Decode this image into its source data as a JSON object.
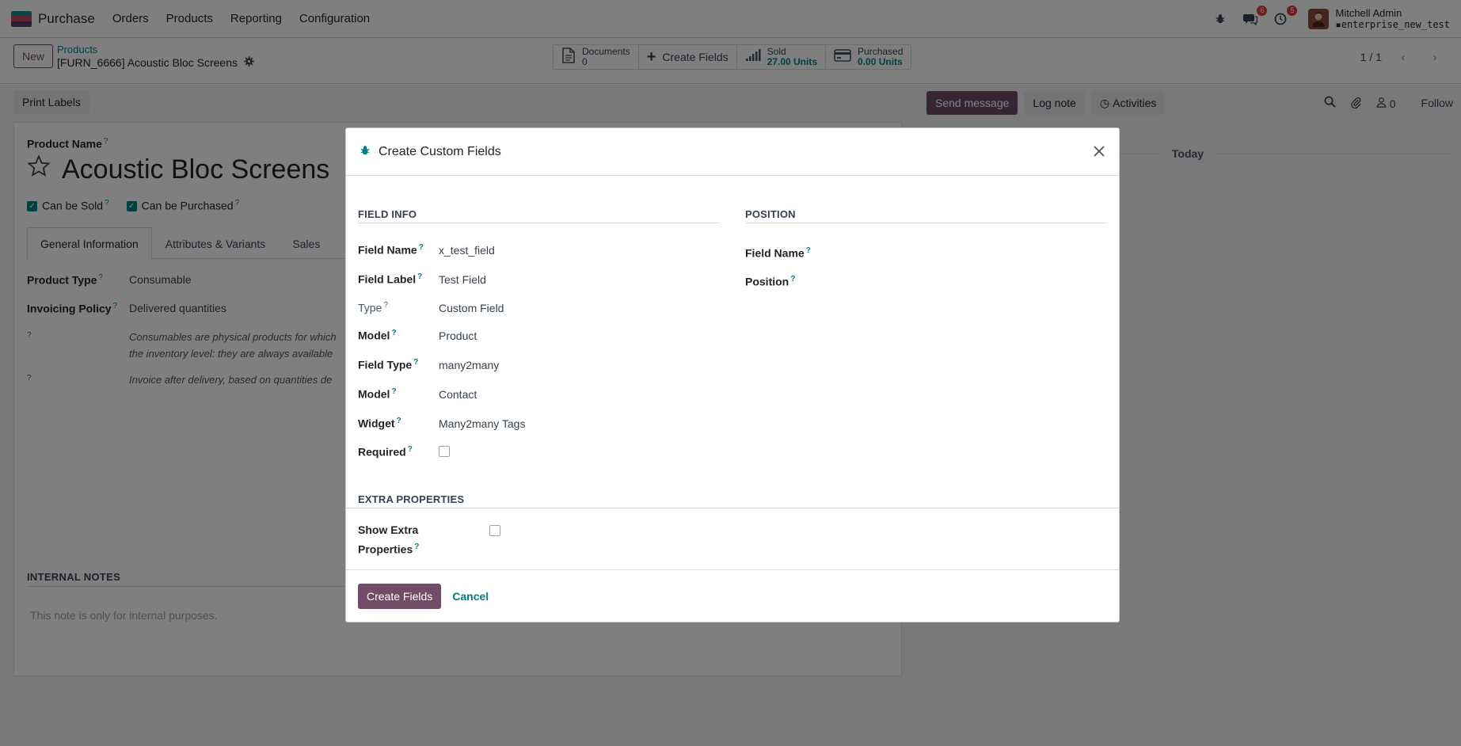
{
  "navbar": {
    "app_name": "Purchase",
    "menu": [
      "Orders",
      "Products",
      "Reporting",
      "Configuration"
    ],
    "messages_badge": "6",
    "activities_badge": "5",
    "user_name": "Mitchell Admin",
    "database": "enterprise_new_test"
  },
  "control_panel": {
    "new_label": "New",
    "breadcrumb_parent": "Products",
    "breadcrumb_current": "[FURN_6666] Acoustic Bloc Screens",
    "smart": {
      "documents_label": "Documents",
      "documents_value": "0",
      "create_fields_label": "Create Fields",
      "sold_label": "Sold",
      "sold_value": "27.00 Units",
      "purchased_label": "Purchased",
      "purchased_value": "0.00 Units"
    },
    "pager": "1 / 1"
  },
  "form": {
    "print_labels": "Print Labels",
    "product_name_label": "Product Name",
    "product_name": "Acoustic Bloc Screens",
    "can_be_sold": "Can be Sold",
    "can_be_purchased": "Can be Purchased",
    "tabs": [
      "General Information",
      "Attributes & Variants",
      "Sales"
    ],
    "product_type_label": "Product Type",
    "product_type": "Consumable",
    "invoicing_policy_label": "Invoicing Policy",
    "invoicing_policy": "Delivered quantities",
    "help_consumable_1": "Consumables are physical products for which",
    "help_consumable_2": "the inventory level: they are always available",
    "help_invoice": "Invoice after delivery, based on quantities de",
    "internal_notes_title": "INTERNAL NOTES",
    "internal_notes_placeholder": "This note is only for internal purposes."
  },
  "chatter": {
    "send_message": "Send message",
    "log_note": "Log note",
    "activities": "Activities",
    "followers_count": "0",
    "follow": "Follow",
    "today": "Today"
  },
  "modal": {
    "title": "Create Custom Fields",
    "field_info_title": "FIELD INFO",
    "position_title": "POSITION",
    "field_info": [
      {
        "label": "Field Name",
        "value": "x_test_field",
        "bold": true
      },
      {
        "label": "Field Label",
        "value": "Test Field",
        "bold": true
      },
      {
        "label": "Type",
        "value": "Custom Field",
        "bold": false
      },
      {
        "label": "Model",
        "value": "Product",
        "bold": true
      },
      {
        "label": "Field Type",
        "value": "many2many",
        "bold": true
      },
      {
        "label": "Model",
        "value": "Contact",
        "bold": true
      },
      {
        "label": "Widget",
        "value": "Many2many Tags",
        "bold": true
      },
      {
        "label": "Required",
        "value": "",
        "bold": true
      }
    ],
    "position": [
      {
        "label": "Field Name"
      },
      {
        "label": "Position"
      }
    ],
    "extra_title": "EXTRA PROPERTIES",
    "show_extra_line1": "Show Extra",
    "show_extra_line2": "Properties",
    "create_button": "Create Fields",
    "cancel_button": "Cancel"
  },
  "colors": {
    "brand": "#714b67",
    "accent": "#017e84",
    "badge": "#e5393b"
  }
}
